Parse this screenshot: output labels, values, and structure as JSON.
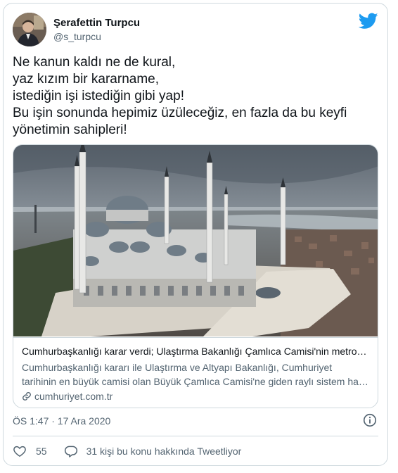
{
  "author": {
    "name": "Şerafettin Turpcu",
    "handle": "@s_turpcu"
  },
  "tweet": {
    "lines": [
      "Ne kanun kaldı ne de kural,",
      "yaz kızım bir kararname,",
      "istediğin işi istediğin gibi yap!",
      "Bu işin sonunda hepimiz üzüleceğiz, en fazla da bu keyfi",
      "yönetimin sahipleri!"
    ]
  },
  "link_card": {
    "title": "Cumhurbaşkanlığı karar verdi; Ulaştırma Bakanlığı Çamlıca Camisi'nin metrosunu yapacak",
    "description_lines": [
      "Cumhurbaşkanlığı kararı ile Ulaştırma ve Altyapı Bakanlığı, Cumhuriyet",
      "tarihinin en büyük camisi olan Büyük Çamlıca Camisi'ne giden raylı sistem hattını yapacak"
    ],
    "domain": "cumhuriyet.com.tr"
  },
  "meta": {
    "timestamp": "ÖS 1:47 · 17 Ara 2020"
  },
  "actions": {
    "like_count": "55",
    "reply_label": "31 kişi bu konu hakkında Tweetliyor"
  },
  "colors": {
    "twitter_blue": "#1d9bf0",
    "secondary_text": "#536471",
    "border": "#cfd9de",
    "like_icon": "#e0245e"
  },
  "icons": [
    "twitter-bird-icon",
    "info-icon",
    "heart-icon",
    "reply-icon",
    "link-icon"
  ]
}
